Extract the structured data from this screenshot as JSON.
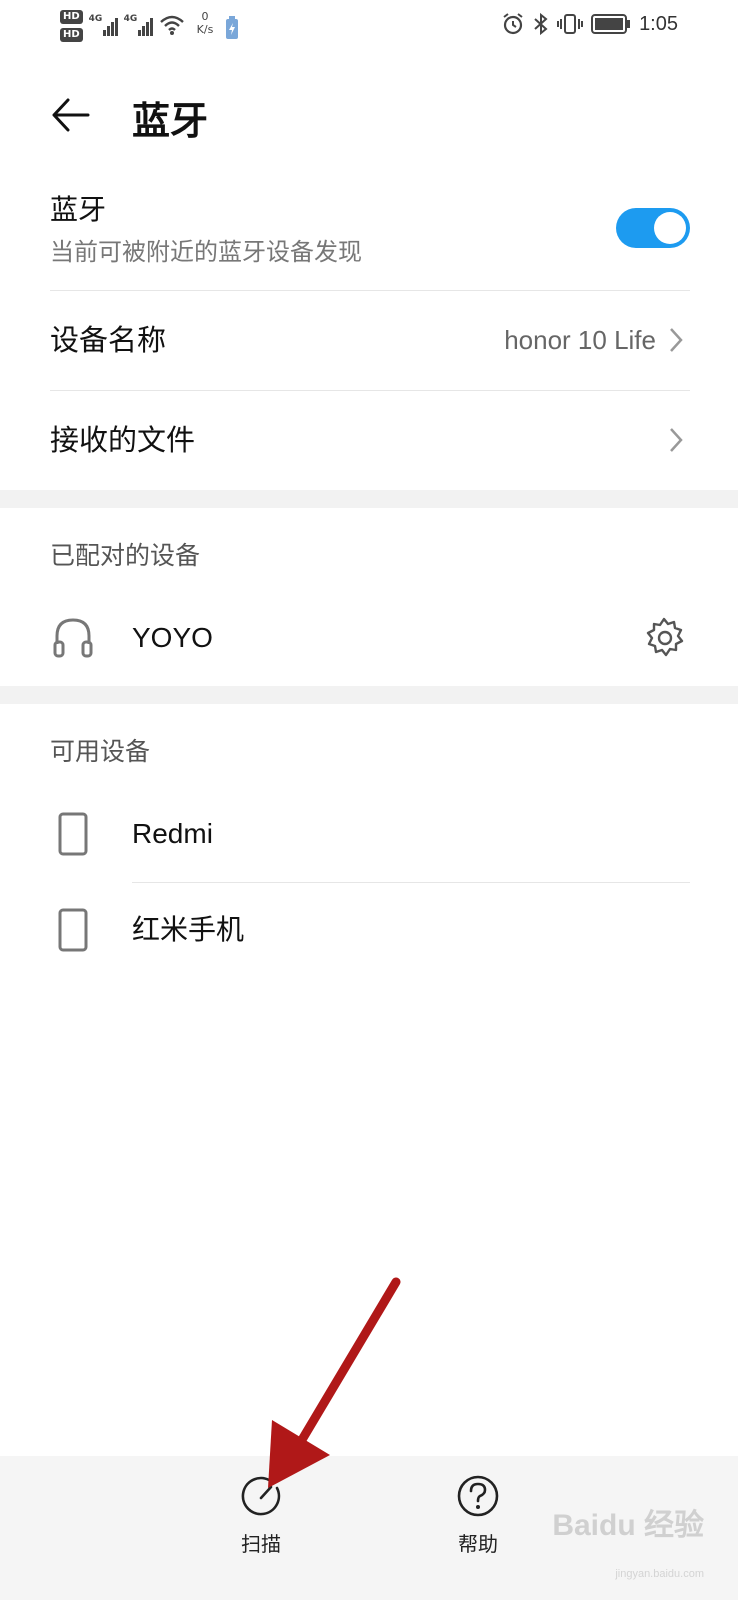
{
  "status_bar": {
    "hd1": "HD",
    "hd2": "HD",
    "net1": "4G",
    "net2": "4G",
    "speed_value": "0",
    "speed_unit": "K/s",
    "time": "1:05"
  },
  "header": {
    "title": "蓝牙"
  },
  "bluetooth": {
    "title": "蓝牙",
    "subtitle": "当前可被附近的蓝牙设备发现",
    "enabled": true,
    "accent_color": "#1d9bf0"
  },
  "settings": {
    "device_name_label": "设备名称",
    "device_name_value": "honor 10 Life",
    "received_files_label": "接收的文件"
  },
  "paired": {
    "heading": "已配对的设备",
    "devices": [
      {
        "name": "YOYO",
        "icon": "headset-icon"
      }
    ]
  },
  "available": {
    "heading": "可用设备",
    "devices": [
      {
        "name": "Redmi",
        "icon": "phone-icon"
      },
      {
        "name": "红米手机",
        "icon": "phone-icon"
      }
    ]
  },
  "bottom_bar": {
    "scan_label": "扫描",
    "help_label": "帮助"
  },
  "watermark": {
    "brand": "Baidu 经验",
    "url": "jingyan.baidu.com"
  }
}
